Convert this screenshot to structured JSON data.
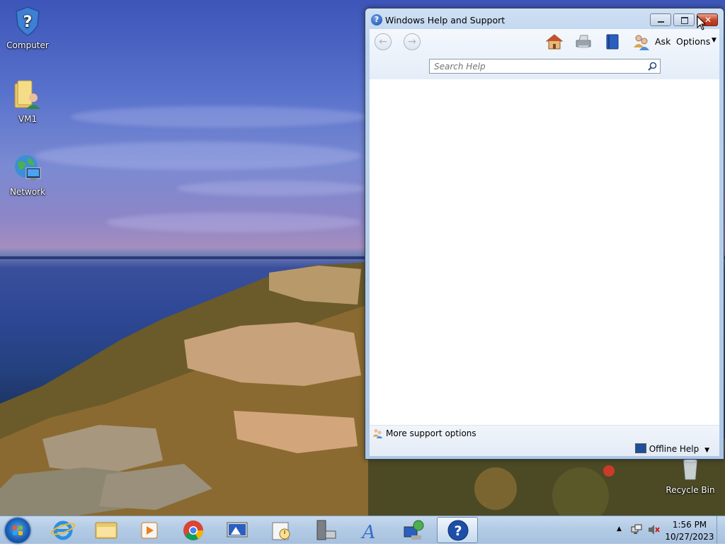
{
  "desktop": {
    "icons": [
      {
        "label": "Computer",
        "icon": "help-shield-icon"
      },
      {
        "label": "VM1",
        "icon": "user-folder-icon"
      },
      {
        "label": "Network",
        "icon": "globe-network-icon"
      },
      {
        "label": "Recycle Bin",
        "icon": "recycle-bin-icon"
      }
    ]
  },
  "window": {
    "title": "Windows Help and Support",
    "toolbar": {
      "back_icon": "back-arrow-icon",
      "forward_icon": "forward-arrow-icon",
      "home_icon": "home-icon",
      "print_icon": "printer-icon",
      "browse_icon": "book-icon",
      "ask_icon": "people-icon",
      "ask_label": "Ask",
      "options_label": "Options"
    },
    "search": {
      "placeholder": "Search Help"
    },
    "bottom": {
      "support_label": "More support options",
      "offline_label": "Offline Help"
    }
  },
  "taskbar": {
    "apps": [
      {
        "name": "internet-explorer-icon"
      },
      {
        "name": "windows-explorer-icon"
      },
      {
        "name": "media-player-icon"
      },
      {
        "name": "chrome-icon"
      },
      {
        "name": "remote-desktop-icon"
      },
      {
        "name": "task-scheduler-icon"
      },
      {
        "name": "server-manager-icon"
      },
      {
        "name": "font-tool-icon"
      },
      {
        "name": "network-sharing-icon"
      },
      {
        "name": "help-support-icon"
      }
    ],
    "clock": {
      "time": "1:56 PM",
      "date": "10/27/2023"
    }
  },
  "colors": {
    "accent": "#1d4fa8",
    "taskbar": "#b3cbe5",
    "close": "#c7462a"
  }
}
